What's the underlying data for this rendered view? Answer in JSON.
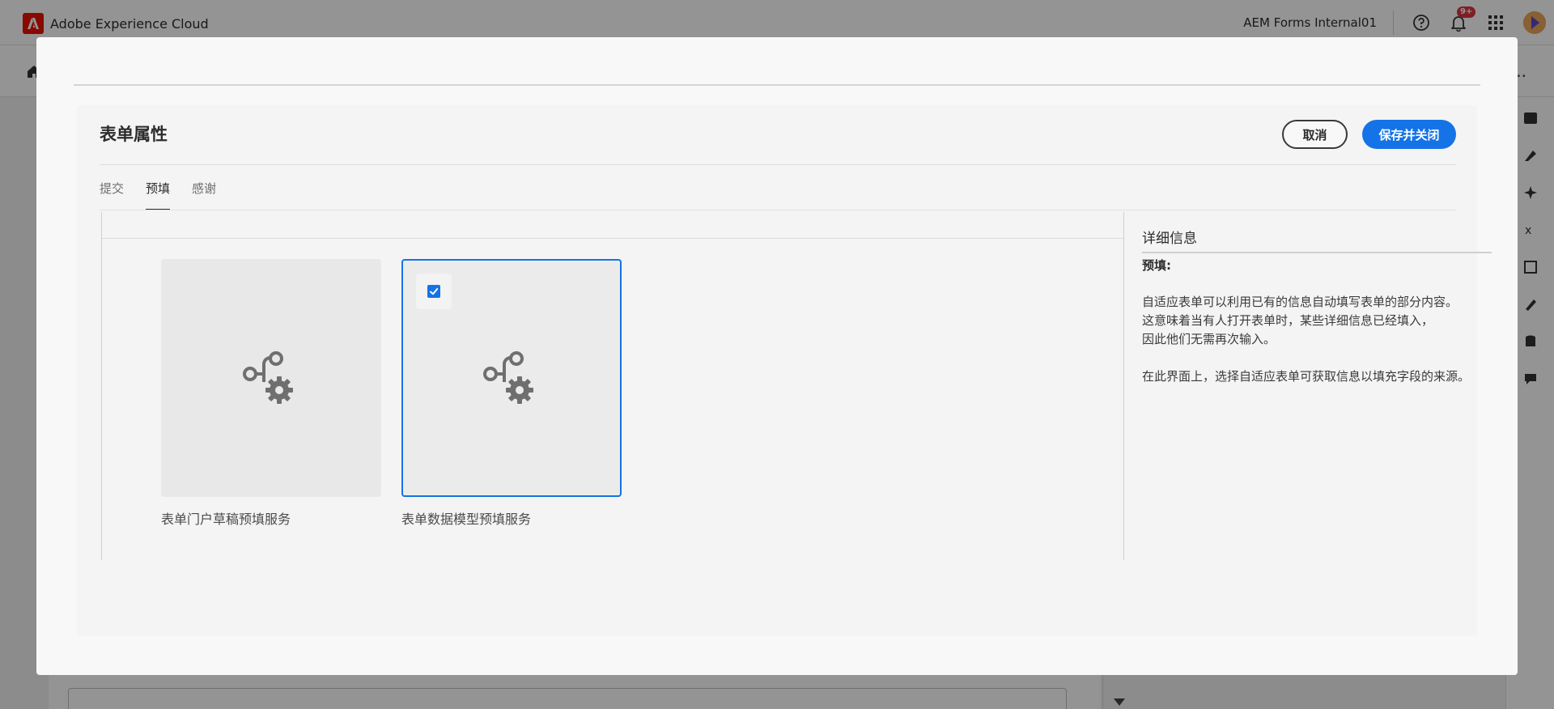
{
  "app": {
    "brand_name": "Adobe Experience Cloud",
    "org_name": "AEM Forms Internal01",
    "notification_count": "9+"
  },
  "dialog": {
    "title": "表单属性",
    "cancel_label": "取消",
    "save_label": "保存并关闭",
    "tabs": [
      {
        "label": "提交",
        "active": false
      },
      {
        "label": "预填",
        "active": true
      },
      {
        "label": "感谢",
        "active": false
      }
    ],
    "services": [
      {
        "label": "表单门户草稿预填服务",
        "selected": false
      },
      {
        "label": "表单数据模型预填服务",
        "selected": true
      }
    ],
    "details": {
      "title": "详细信息",
      "label": "预填:",
      "paragraph1_line1": "自适应表单可以利用已有的信息自动填写表单的部分内容。",
      "paragraph1_line2": "这意味着当有人打开表单时，某些详细信息已经填入，",
      "paragraph1_line3": "因此他们无需再次输入。",
      "paragraph2": "在此界面上，选择自适应表单可获取信息以填充字段的来源。"
    }
  },
  "colors": {
    "accent": "#1473e6",
    "adobe_red": "#eb1000",
    "badge": "#d7373f"
  },
  "icons": [
    "adobe-logo-icon",
    "help-icon",
    "bell-icon",
    "apps-grid-icon",
    "home-icon",
    "more-icon",
    "service-gear-icon",
    "checkmark-icon",
    "caret-down-icon"
  ]
}
